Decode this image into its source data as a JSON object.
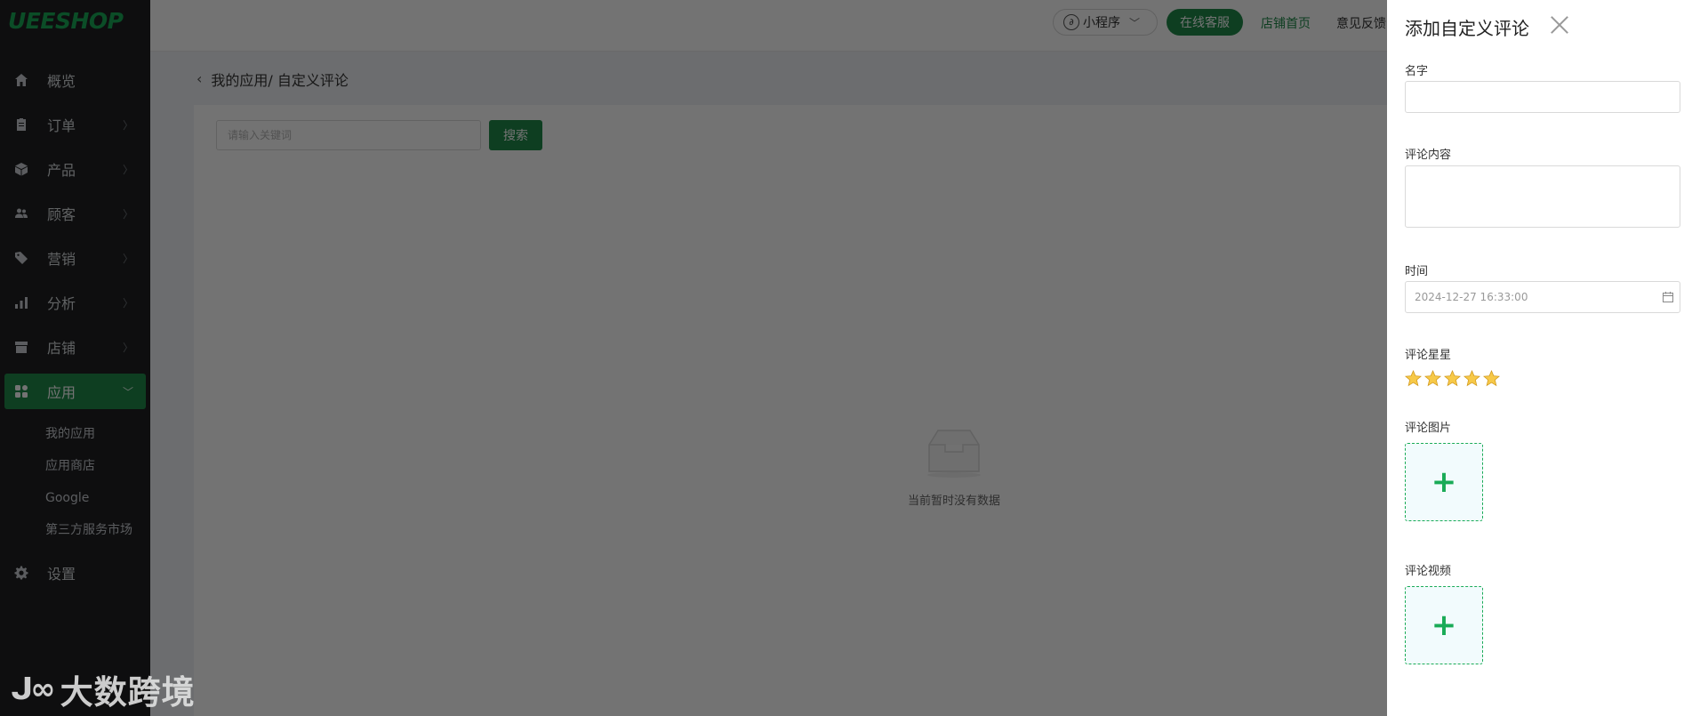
{
  "brand": {
    "logo": "UEESHOP",
    "accent": "#1f8a4a",
    "logo_color": "#1aab57"
  },
  "sidebar": {
    "items": [
      {
        "label": "概览",
        "icon": "home-icon",
        "has_arrow": false
      },
      {
        "label": "订单",
        "icon": "clipboard-icon",
        "has_arrow": true
      },
      {
        "label": "产品",
        "icon": "box-icon",
        "has_arrow": true
      },
      {
        "label": "顾客",
        "icon": "users-icon",
        "has_arrow": true
      },
      {
        "label": "营销",
        "icon": "tag-icon",
        "has_arrow": true
      },
      {
        "label": "分析",
        "icon": "bar-chart-icon",
        "has_arrow": true
      },
      {
        "label": "店铺",
        "icon": "store-icon",
        "has_arrow": true
      },
      {
        "label": "应用",
        "icon": "apps-icon",
        "has_arrow": true,
        "active": true
      }
    ],
    "sub_items": [
      "我的应用",
      "应用商店",
      "Google",
      "第三方服务市场"
    ],
    "settings": {
      "label": "设置",
      "icon": "gear-icon"
    }
  },
  "watermark": {
    "text": "大数跨境"
  },
  "topbar": {
    "mini_program": "小程序",
    "online_service": "在线客服",
    "store_home": "店铺首页",
    "feedback": "意见反馈"
  },
  "breadcrumb": {
    "text": "我的应用/ 自定义评论"
  },
  "search": {
    "placeholder": "请输入关键词",
    "button": "搜索"
  },
  "empty_state": {
    "text": "当前暂时没有数据"
  },
  "drawer": {
    "title": "添加自定义评论",
    "name_label": "名字",
    "name_value": "",
    "content_label": "评论内容",
    "content_value": "",
    "time_label": "时间",
    "time_value": "2024-12-27 16:33:00",
    "stars_label": "评论星星",
    "stars": 5,
    "images_label": "评论图片",
    "video_label": "评论视频",
    "upload_icon": "plus-icon"
  }
}
